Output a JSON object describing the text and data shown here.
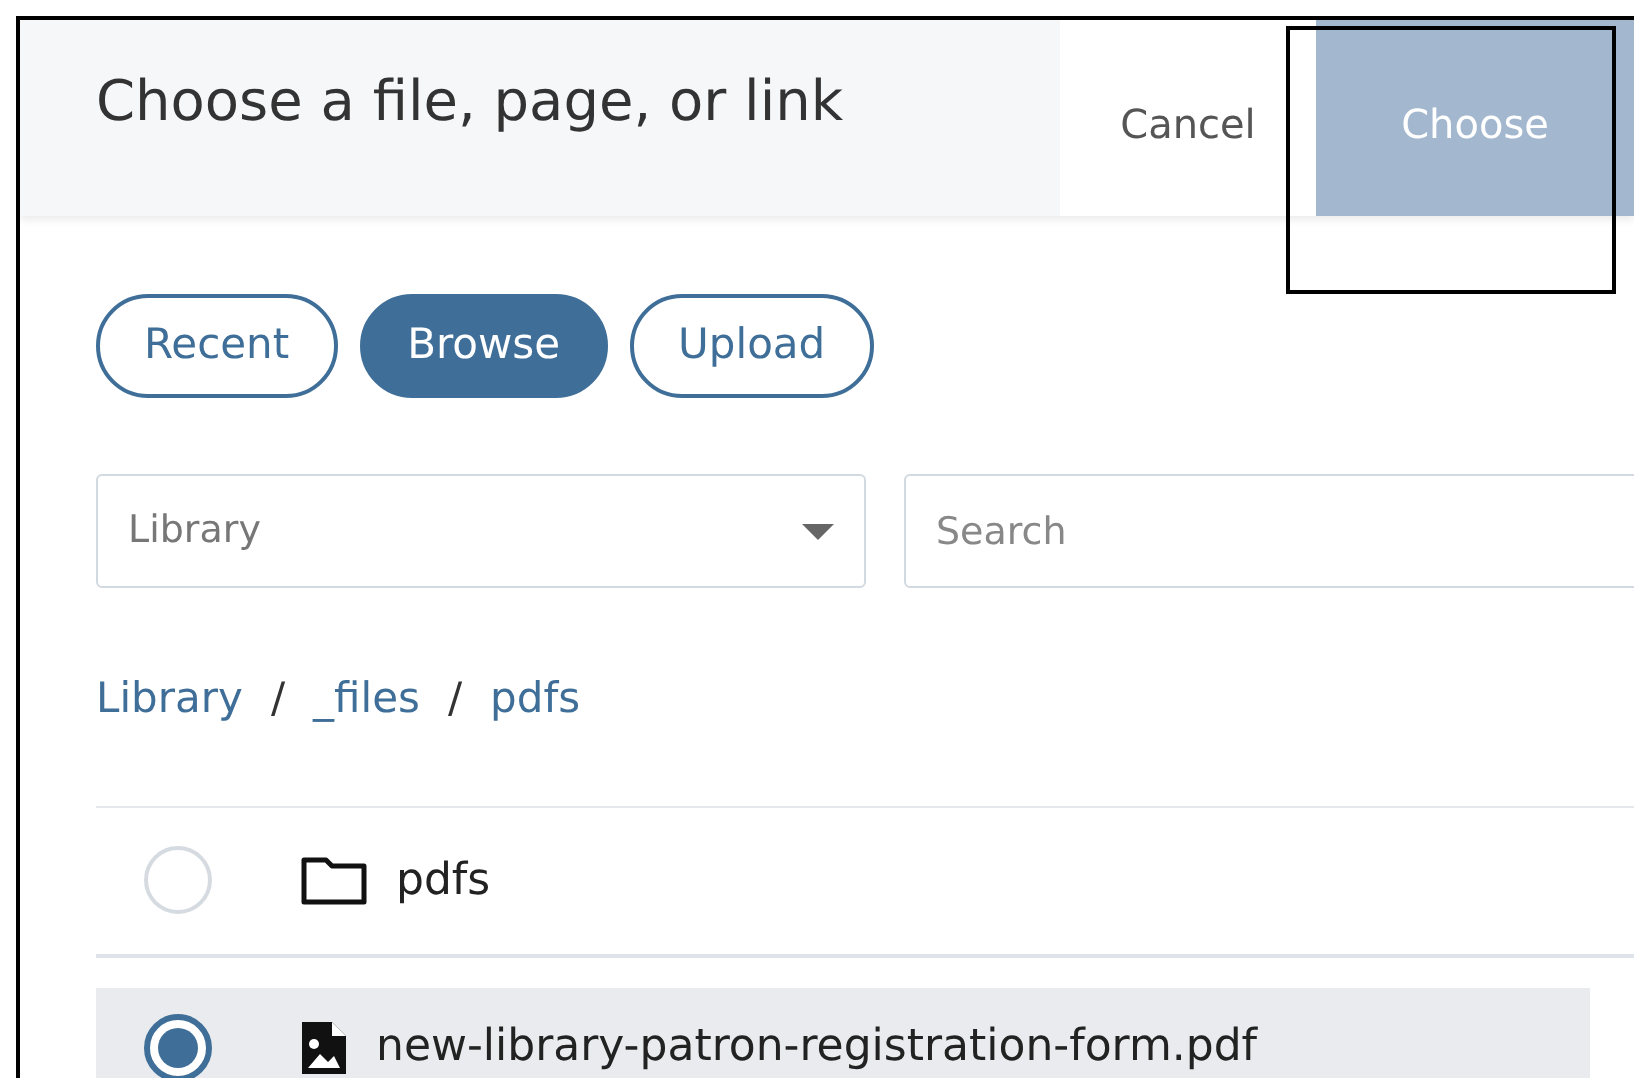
{
  "dialog": {
    "title": "Choose a file, page, or link",
    "buttons": [
      {
        "kind": "cancel",
        "label": "Cancel"
      },
      {
        "kind": "primary",
        "label": "Choose",
        "disabled": true
      }
    ]
  },
  "tabs": [
    {
      "label": "Recent",
      "selected": false
    },
    {
      "label": "Browse",
      "selected": true
    },
    {
      "label": "Upload",
      "selected": false
    }
  ],
  "library_select": {
    "value": "Library"
  },
  "search": {
    "placeholder": "Search"
  },
  "breadcrumb": {
    "separator": "/",
    "parts": [
      "Library",
      "_files",
      "pdfs"
    ]
  },
  "items": [
    {
      "kind": "folder",
      "name": "pdfs",
      "selected": false
    },
    {
      "kind": "file",
      "name": "new-library-patron-registration-form.pdf",
      "selected": true
    }
  ]
}
